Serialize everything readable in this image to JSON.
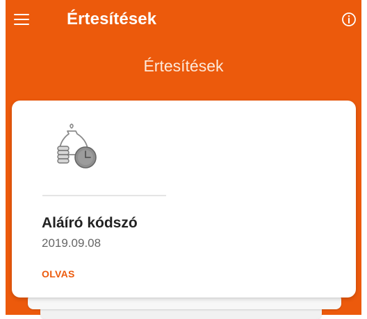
{
  "header": {
    "title": "Értesítések",
    "menu_icon": "menu-icon",
    "info_icon": "info-icon"
  },
  "subheader": {
    "title": "Értesítések"
  },
  "notifications": [
    {
      "icon": "money-bag-clock-icon",
      "title": "Aláíró kódszó",
      "date": "2019.09.08",
      "action_label": "OLVAS"
    }
  ],
  "colors": {
    "brand": "#ec5a0c",
    "card": "#ffffff",
    "title_text": "#222222",
    "date_text": "#666666",
    "subheader_text": "#fde9da"
  }
}
